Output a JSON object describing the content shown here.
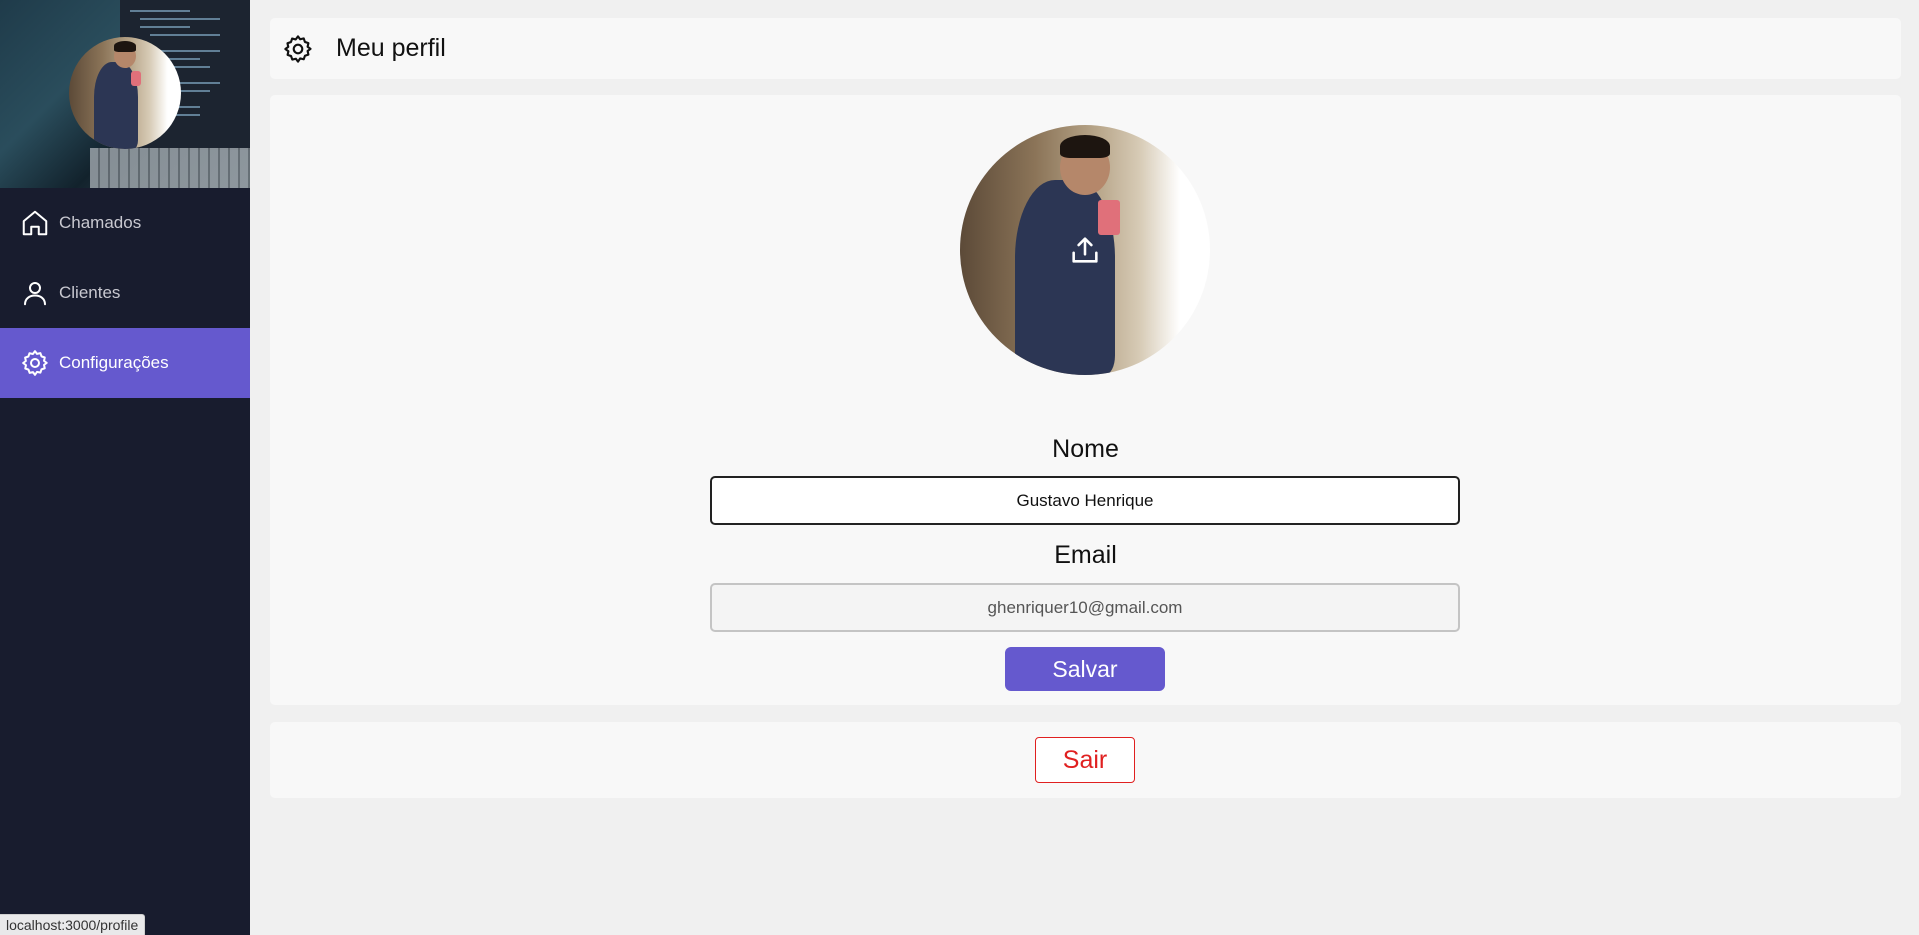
{
  "sidebar": {
    "items": [
      {
        "label": "Chamados",
        "icon": "home-icon"
      },
      {
        "label": "Clientes",
        "icon": "user-icon"
      },
      {
        "label": "Configurações",
        "icon": "gear-icon",
        "active": true
      }
    ]
  },
  "header": {
    "title": "Meu perfil",
    "icon": "gear-icon"
  },
  "profile": {
    "name_label": "Nome",
    "name_value": "Gustavo Henrique",
    "email_label": "Email",
    "email_value": "ghenriquer10@gmail.com",
    "save_label": "Salvar",
    "upload_icon": "upload-icon"
  },
  "logout": {
    "label": "Sair"
  },
  "status_bar": {
    "url": "localhost:3000/profile"
  },
  "colors": {
    "accent": "#6559ce",
    "sidebar_bg": "#181c2e",
    "danger": "#e02020"
  }
}
